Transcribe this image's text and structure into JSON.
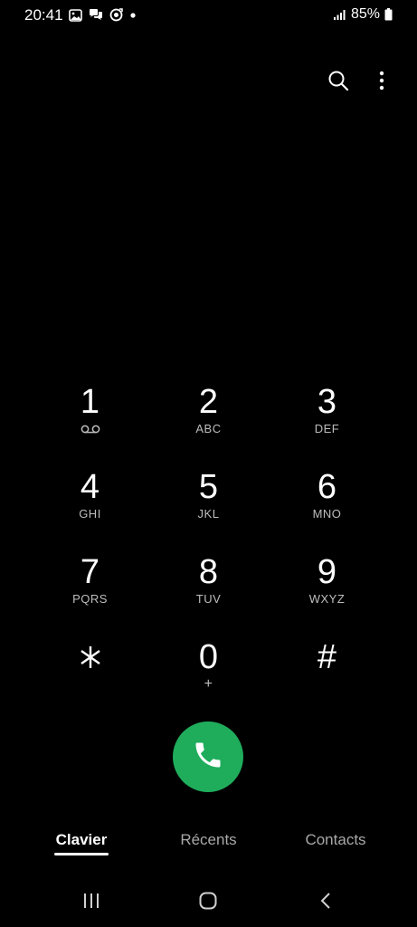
{
  "status_bar": {
    "time": "20:41",
    "battery_percent": "85%",
    "left_icons": [
      "gallery-icon",
      "chat-bubbles-icon",
      "sync-circle-icon",
      "dot-icon"
    ],
    "right_icons": [
      "signal-icon",
      "battery-icon"
    ]
  },
  "top_actions": {
    "icons": [
      "search-icon",
      "more-vertical-icon"
    ]
  },
  "keypad": {
    "keys": [
      {
        "digit": "1",
        "letters": "",
        "sub_icon": "voicemail-icon"
      },
      {
        "digit": "2",
        "letters": "ABC"
      },
      {
        "digit": "3",
        "letters": "DEF"
      },
      {
        "digit": "4",
        "letters": "GHI"
      },
      {
        "digit": "5",
        "letters": "JKL"
      },
      {
        "digit": "6",
        "letters": "MNO"
      },
      {
        "digit": "7",
        "letters": "PQRS"
      },
      {
        "digit": "8",
        "letters": "TUV"
      },
      {
        "digit": "9",
        "letters": "WXYZ"
      },
      {
        "digit": "",
        "letters": "",
        "icon": "asterisk-icon"
      },
      {
        "digit": "0",
        "letters": "+"
      },
      {
        "digit": "#",
        "letters": ""
      }
    ]
  },
  "call_button": {
    "icon": "phone-icon",
    "color": "#1fad5c"
  },
  "tabs": [
    {
      "label": "Clavier",
      "active": true
    },
    {
      "label": "Récents",
      "active": false
    },
    {
      "label": "Contacts",
      "active": false
    }
  ],
  "nav_bar": {
    "icons": [
      "recent-apps-icon",
      "home-icon",
      "back-icon"
    ]
  }
}
